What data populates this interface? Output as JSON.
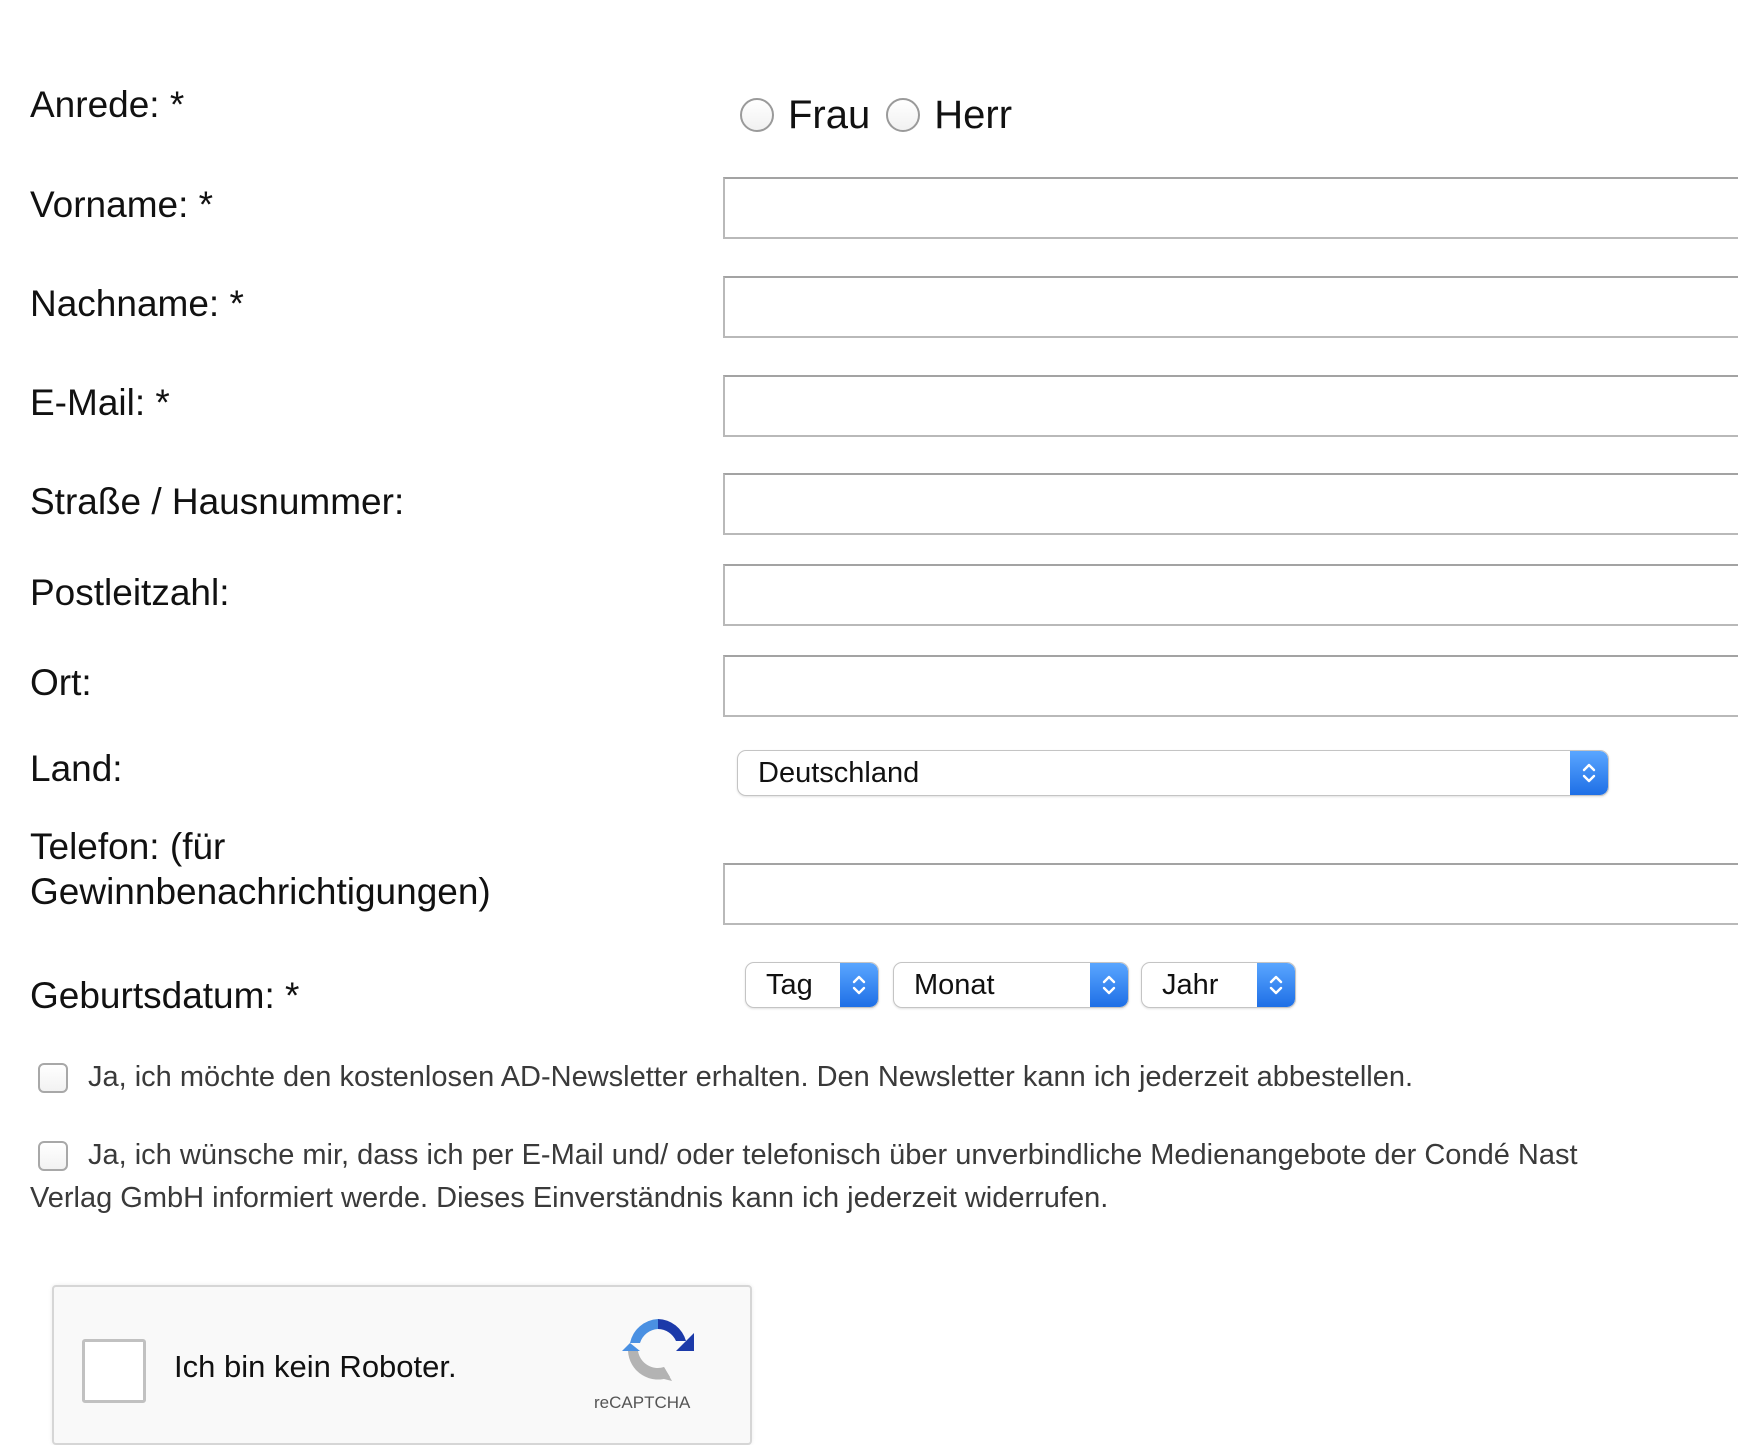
{
  "form": {
    "salutation": {
      "label": "Anrede: *",
      "options": [
        "Frau",
        "Herr"
      ]
    },
    "first_name": {
      "label": "Vorname: *",
      "value": ""
    },
    "last_name": {
      "label": "Nachname: *",
      "value": ""
    },
    "email": {
      "label": "E-Mail: *",
      "value": ""
    },
    "street": {
      "label": "Straße / Hausnummer:",
      "value": ""
    },
    "postal_code": {
      "label": "Postleitzahl:",
      "value": ""
    },
    "city": {
      "label": "Ort:",
      "value": ""
    },
    "country": {
      "label": "Land:",
      "selected": "Deutschland"
    },
    "phone": {
      "label_line1": "Telefon: (für",
      "label_line2": "Gewinnbenachrichtigungen)",
      "value": ""
    },
    "birthdate": {
      "label": "Geburtsdatum: *",
      "day": "Tag",
      "month": "Monat",
      "year": "Jahr"
    },
    "newsletter": {
      "text": "Ja, ich möchte den kostenlosen AD-Newsletter erhalten. Den Newsletter kann ich jederzeit abbestellen.",
      "checked": false
    },
    "media_offers": {
      "text_line1": "Ja, ich wünsche mir, dass ich per E-Mail und/ oder telefonisch über unverbindliche Medienangebote der Condé Nast",
      "text_line2": "Verlag GmbH informiert werde. Dieses Einverständnis kann ich jederzeit widerrufen.",
      "checked": false
    }
  },
  "recaptcha": {
    "label": "Ich bin kein Roboter.",
    "brand": "reCAPTCHA",
    "logo_icon": "recaptcha-logo-icon"
  },
  "colors": {
    "select_arrow": "#2f80ed",
    "input_border": "#b9b9b9",
    "recaptcha_blue": "#1c3aa9",
    "recaptcha_light_blue": "#4a90e2",
    "recaptcha_gray": "#b3b3b3"
  }
}
